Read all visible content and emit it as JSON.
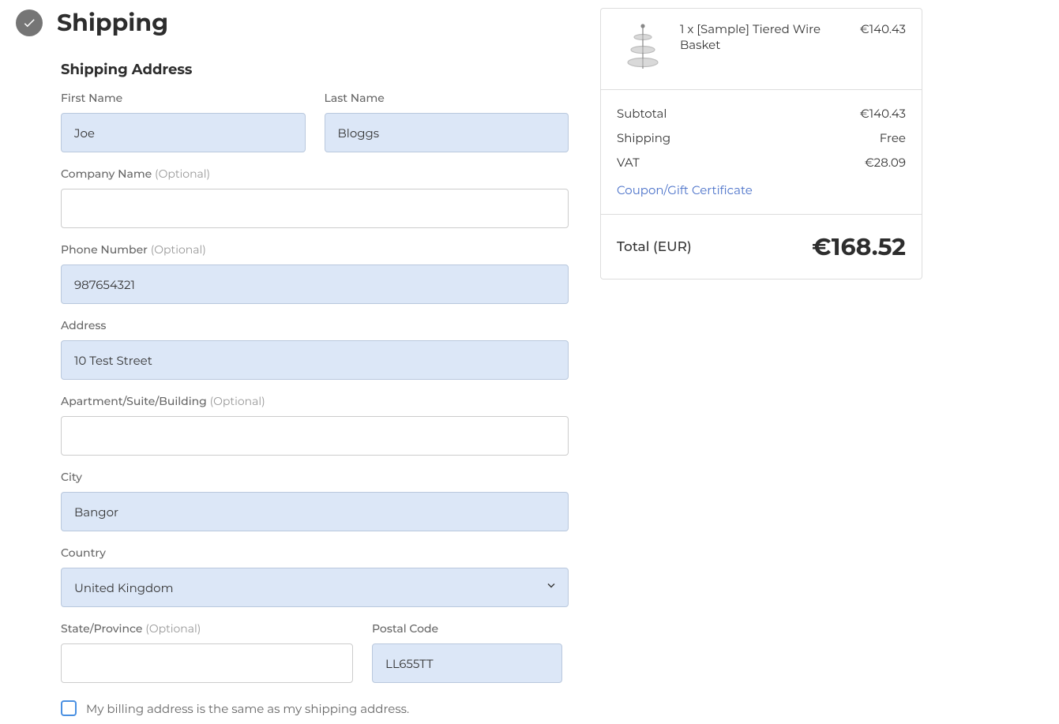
{
  "shipping": {
    "section_title": "Shipping",
    "subsection_title": "Shipping Address",
    "labels": {
      "first_name": "First Name",
      "last_name": "Last Name",
      "company": "Company Name",
      "phone": "Phone Number",
      "address": "Address",
      "apartment": "Apartment/Suite/Building",
      "city": "City",
      "country": "Country",
      "state": "State/Province",
      "postal": "Postal Code",
      "optional": "(Optional)"
    },
    "values": {
      "first_name": "Joe",
      "last_name": "Bloggs",
      "company": "",
      "phone": "987654321",
      "address": "10 Test Street",
      "apartment": "",
      "city": "Bangor",
      "country": "United Kingdom",
      "state": "",
      "postal": "LL655TT"
    },
    "billing_same_label": "My billing address is the same as my shipping address."
  },
  "order": {
    "item": {
      "qty_name": "1 x [Sample] Tiered Wire Basket",
      "price": "€140.43"
    },
    "subtotal_label": "Subtotal",
    "subtotal_value": "€140.43",
    "shipping_label": "Shipping",
    "shipping_value": "Free",
    "vat_label": "VAT",
    "vat_value": "€28.09",
    "coupon_link": "Coupon/Gift Certificate",
    "total_label": "Total (EUR)",
    "total_value": "€168.52"
  }
}
